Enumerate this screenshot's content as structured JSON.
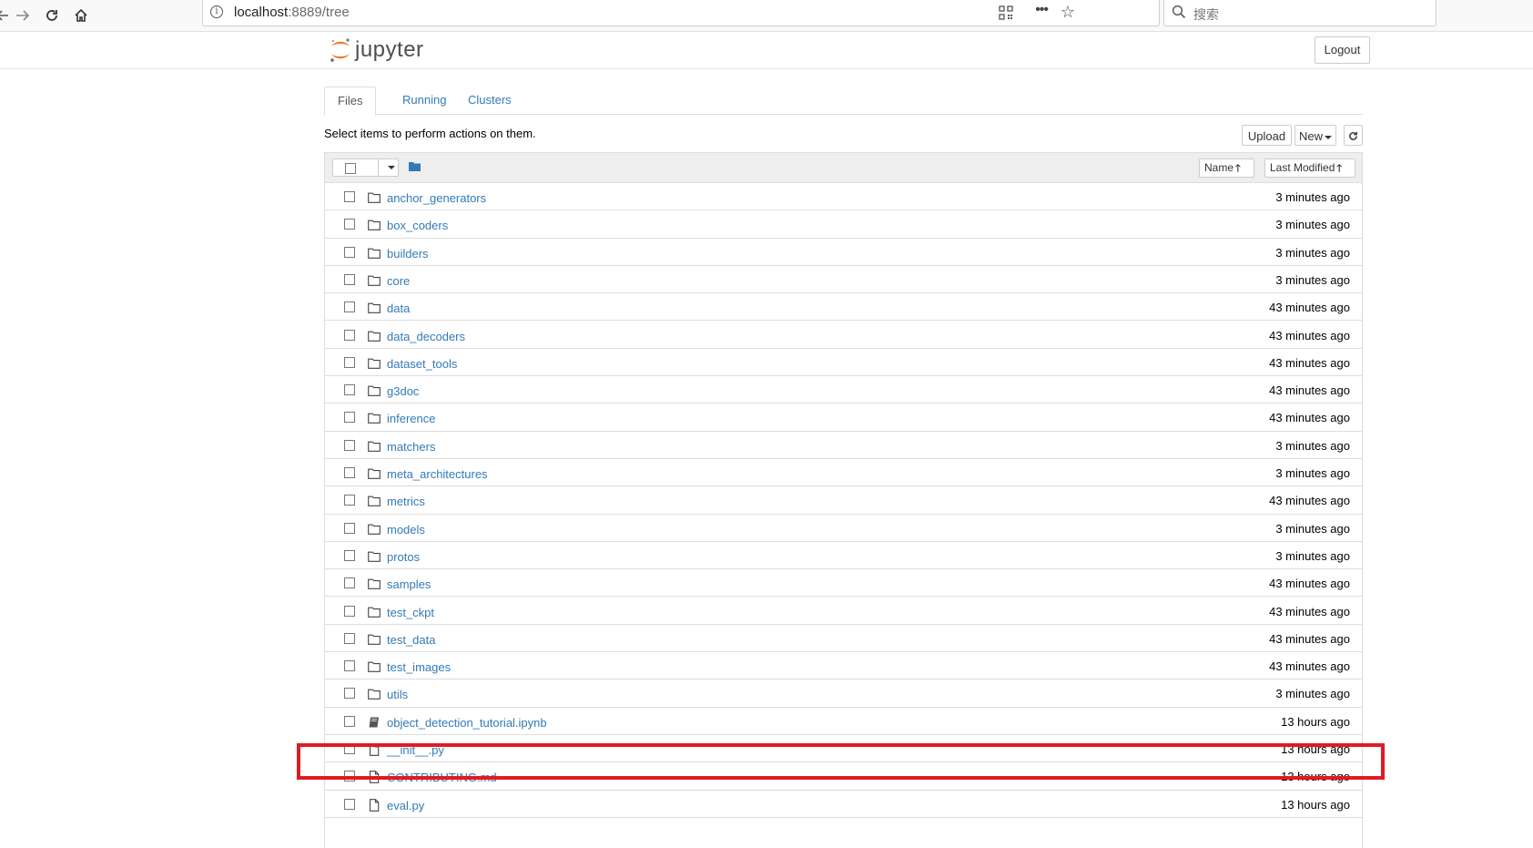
{
  "browser": {
    "url_host": "localhost",
    "url_rest": ":8889/tree",
    "search_placeholder": "搜索"
  },
  "header": {
    "logo_text": "jupyter",
    "logout_label": "Logout"
  },
  "tabs": [
    {
      "label": "Files",
      "active": true
    },
    {
      "label": "Running",
      "active": false
    },
    {
      "label": "Clusters",
      "active": false
    }
  ],
  "toolbar": {
    "hint": "Select items to perform actions on them.",
    "upload_label": "Upload",
    "new_label": "New",
    "refresh_icon": "refresh-icon"
  },
  "list_header": {
    "name_label": "Name",
    "modified_label": "Last Modified"
  },
  "files": [
    {
      "name": "anchor_generators",
      "type": "folder",
      "modified": "3 minutes ago"
    },
    {
      "name": "box_coders",
      "type": "folder",
      "modified": "3 minutes ago"
    },
    {
      "name": "builders",
      "type": "folder",
      "modified": "3 minutes ago"
    },
    {
      "name": "core",
      "type": "folder",
      "modified": "3 minutes ago"
    },
    {
      "name": "data",
      "type": "folder",
      "modified": "43 minutes ago"
    },
    {
      "name": "data_decoders",
      "type": "folder",
      "modified": "43 minutes ago"
    },
    {
      "name": "dataset_tools",
      "type": "folder",
      "modified": "43 minutes ago"
    },
    {
      "name": "g3doc",
      "type": "folder",
      "modified": "43 minutes ago"
    },
    {
      "name": "inference",
      "type": "folder",
      "modified": "43 minutes ago"
    },
    {
      "name": "matchers",
      "type": "folder",
      "modified": "3 minutes ago"
    },
    {
      "name": "meta_architectures",
      "type": "folder",
      "modified": "3 minutes ago"
    },
    {
      "name": "metrics",
      "type": "folder",
      "modified": "43 minutes ago"
    },
    {
      "name": "models",
      "type": "folder",
      "modified": "3 minutes ago"
    },
    {
      "name": "protos",
      "type": "folder",
      "modified": "3 minutes ago"
    },
    {
      "name": "samples",
      "type": "folder",
      "modified": "43 minutes ago"
    },
    {
      "name": "test_ckpt",
      "type": "folder",
      "modified": "43 minutes ago"
    },
    {
      "name": "test_data",
      "type": "folder",
      "modified": "43 minutes ago"
    },
    {
      "name": "test_images",
      "type": "folder",
      "modified": "43 minutes ago"
    },
    {
      "name": "utils",
      "type": "folder",
      "modified": "3 minutes ago"
    },
    {
      "name": "object_detection_tutorial.ipynb",
      "type": "notebook",
      "modified": "13 hours ago"
    },
    {
      "name": "__init__.py",
      "type": "file",
      "modified": "13 hours ago"
    },
    {
      "name": "CONTRIBUTING.md",
      "type": "file",
      "modified": "13 hours ago"
    },
    {
      "name": "eval.py",
      "type": "file",
      "modified": "13 hours ago"
    }
  ],
  "colors": {
    "link": "#337ab7",
    "highlight": "#e01b24",
    "jupyter_orange": "#f37726"
  }
}
